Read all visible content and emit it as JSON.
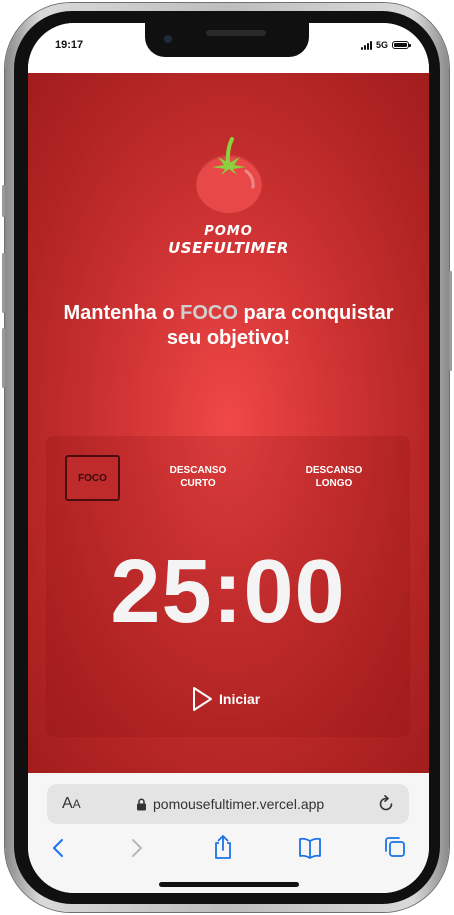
{
  "status_bar": {
    "time": "19:17",
    "network": "5G",
    "icons": [
      "signal-bars-icon",
      "battery-icon"
    ]
  },
  "app": {
    "logo": {
      "icon": "tomato-icon",
      "line1": "POMO",
      "line2": "USEFULTIMER"
    },
    "headline": {
      "before": "Mantenha o ",
      "highlight": "FOCO",
      "after": " para conquistar seu objetivo!"
    },
    "modes": [
      {
        "line1": "FOCO",
        "line2": "",
        "active": true
      },
      {
        "line1": "DESCANSO",
        "line2": "CURTO",
        "active": false
      },
      {
        "line1": "DESCANSO",
        "line2": "LONGO",
        "active": false
      }
    ],
    "timer": "25:00",
    "start_button": {
      "label": "Iniciar",
      "icon": "play-icon"
    }
  },
  "browser": {
    "text_size_big": "A",
    "text_size_small": "A",
    "url": "pomousefultimer.vercel.app",
    "icons": [
      "lock-icon",
      "reload-icon",
      "back-icon",
      "forward-icon",
      "share-icon",
      "bookmarks-icon",
      "tabs-icon"
    ]
  },
  "colors": {
    "background_red": "#d33535",
    "card": "#a81f1f",
    "highlight_text": "#d0d0d0",
    "ios_blue": "#1a73e8"
  }
}
